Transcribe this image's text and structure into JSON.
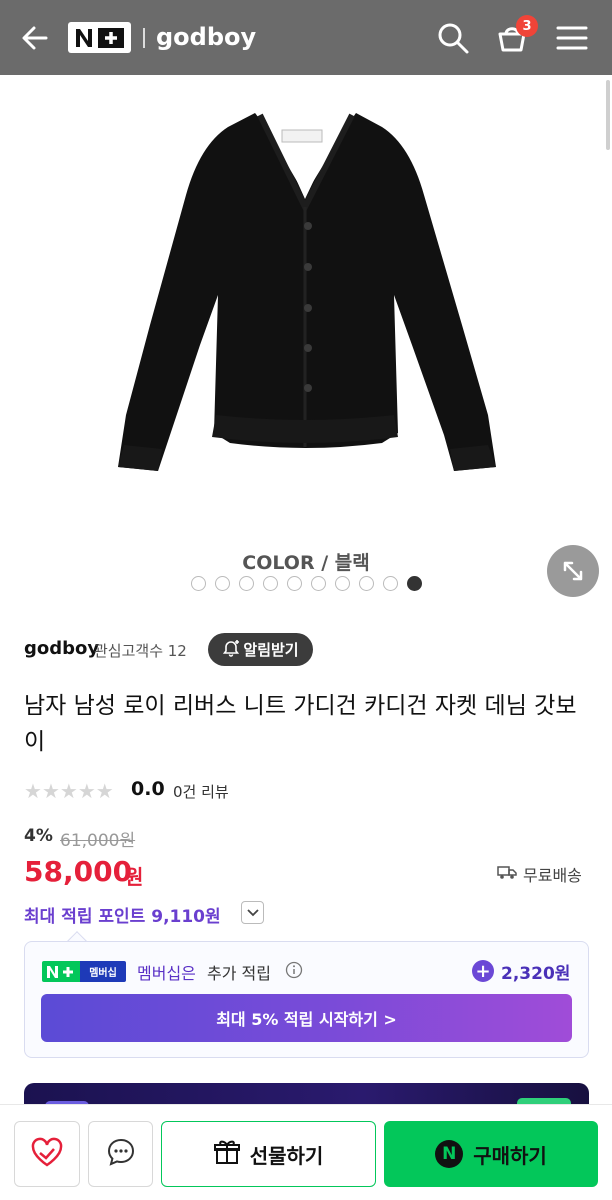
{
  "header": {
    "brand": "godboy",
    "cart_count": "3",
    "nplus_logo_text": "N+"
  },
  "gallery": {
    "caption": "COLOR / 블랙",
    "dots_total": 10,
    "active_dot": 10
  },
  "store": {
    "name": "godboy",
    "followers": "관심고객수 12",
    "alarm_label": "알림받기"
  },
  "product": {
    "title": "남자 남성 로이 리버스 니트 가디건 카디건 자켓 데님 갓보이",
    "rating": "0.0",
    "review_count": "0건 리뷰",
    "discount": "4%",
    "original_price": "61,000원",
    "price": "58,000",
    "currency": "원",
    "shipping": "무료배송",
    "max_points": "최대 적립 포인트 9,110원"
  },
  "membership": {
    "logo_text": "멤버십",
    "label_highlight": "멤버십은",
    "label_rest": "추가 적립",
    "extra_points": "2,320원",
    "cta": "최대 5% 적립 시작하기 >"
  },
  "bottom_bar": {
    "gift_label": "선물하기",
    "buy_label": "구매하기",
    "buy_logo": "N"
  },
  "colors": {
    "header_bg": "#6b6b6b",
    "price_red": "#e5203a",
    "naver_green": "#03c75a",
    "points_purple": "#6a3fcf"
  },
  "icons": [
    "back-arrow-icon",
    "search-icon",
    "cart-icon",
    "menu-icon",
    "expand-icon",
    "bell-plus-icon",
    "star-icon",
    "truck-icon",
    "chevron-down-icon",
    "info-icon",
    "heart-icon",
    "chat-icon",
    "gift-icon"
  ]
}
